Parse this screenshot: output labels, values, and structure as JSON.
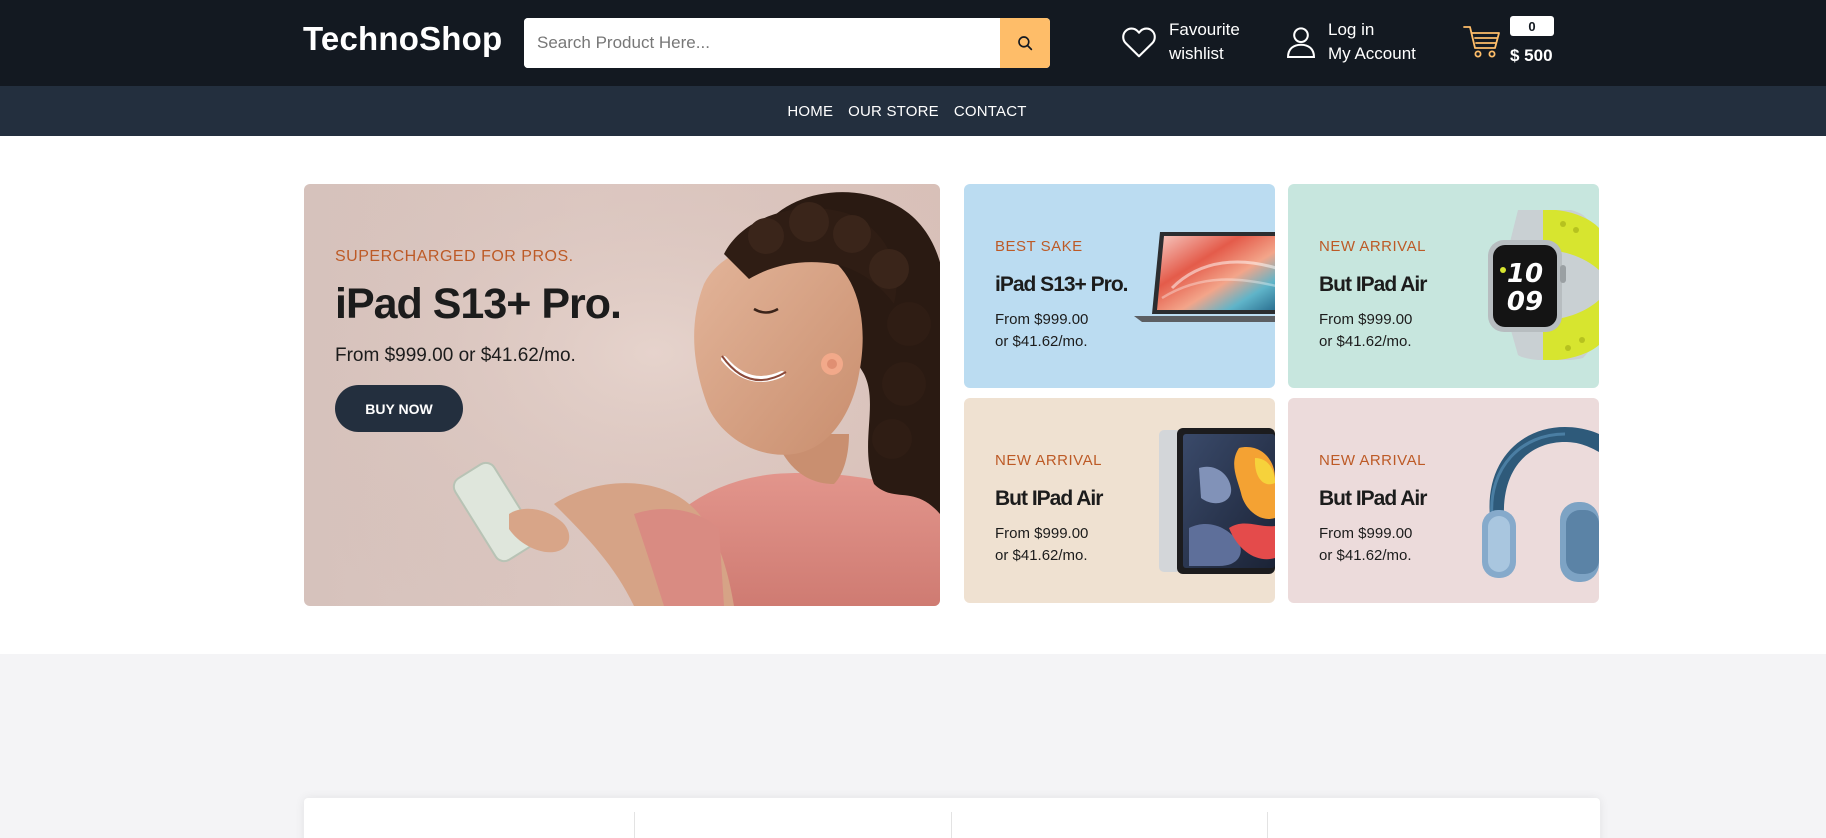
{
  "header": {
    "brand": "TechnoShop",
    "search_placeholder": "Search Product Here...",
    "wishlist": {
      "line1": "Favourite",
      "line2": "wishlist"
    },
    "account": {
      "line1": "Log in",
      "line2": "My Account"
    },
    "cart": {
      "count": "0",
      "total": "$ 500"
    }
  },
  "nav": {
    "items": [
      "HOME",
      "OUR STORE",
      "CONTACT"
    ]
  },
  "hero": {
    "main": {
      "eyebrow": "SUPERCHARGED FOR PROS.",
      "title": "iPad S13+ Pro.",
      "price": "From $999.00 or $41.62/mo.",
      "button": "BUY NOW"
    },
    "small": [
      {
        "eyebrow": "BEST SAKE",
        "title": "iPad S13+ Pro.",
        "price_line1": "From $999.00",
        "price_line2": "or $41.62/mo."
      },
      {
        "eyebrow": "NEW ARRIVAL",
        "title": "But IPad Air",
        "price_line1": "From $999.00",
        "price_line2": "or $41.62/mo."
      },
      {
        "eyebrow": "NEW ARRIVAL",
        "title": "But IPad Air",
        "price_line1": "From $999.00",
        "price_line2": "or $41.62/mo."
      },
      {
        "eyebrow": "NEW ARRIVAL",
        "title": "But IPad Air",
        "price_line1": "From $999.00",
        "price_line2": "or $41.62/mo."
      }
    ],
    "watch_face": {
      "hour": "10",
      "minute": "09"
    }
  },
  "colors": {
    "header_bg": "#131921",
    "nav_bg": "#232f3e",
    "accent": "#febd69",
    "eyebrow": "#bd5a26"
  }
}
